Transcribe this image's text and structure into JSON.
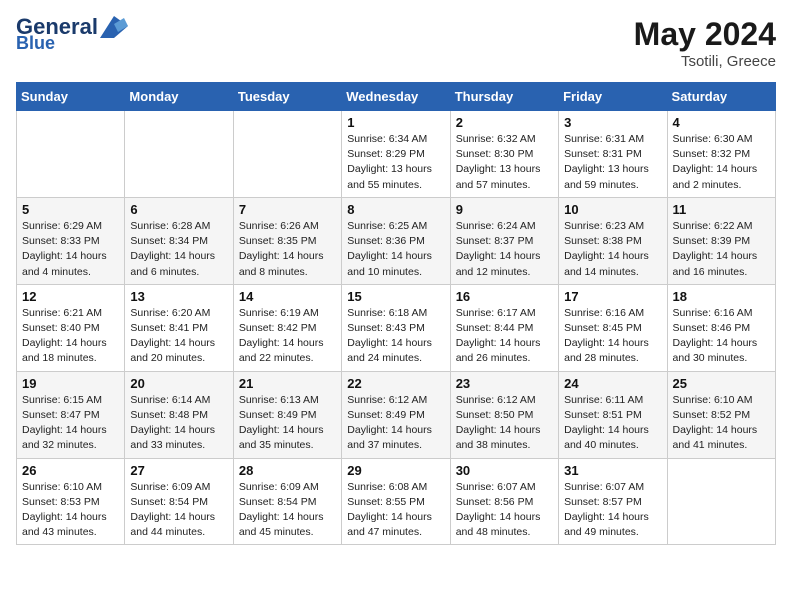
{
  "header": {
    "logo_line1": "General",
    "logo_line2": "Blue",
    "month_year": "May 2024",
    "location": "Tsotili, Greece"
  },
  "weekdays": [
    "Sunday",
    "Monday",
    "Tuesday",
    "Wednesday",
    "Thursday",
    "Friday",
    "Saturday"
  ],
  "weeks": [
    [
      {
        "day": "",
        "info": ""
      },
      {
        "day": "",
        "info": ""
      },
      {
        "day": "",
        "info": ""
      },
      {
        "day": "1",
        "info": "Sunrise: 6:34 AM\nSunset: 8:29 PM\nDaylight: 13 hours\nand 55 minutes."
      },
      {
        "day": "2",
        "info": "Sunrise: 6:32 AM\nSunset: 8:30 PM\nDaylight: 13 hours\nand 57 minutes."
      },
      {
        "day": "3",
        "info": "Sunrise: 6:31 AM\nSunset: 8:31 PM\nDaylight: 13 hours\nand 59 minutes."
      },
      {
        "day": "4",
        "info": "Sunrise: 6:30 AM\nSunset: 8:32 PM\nDaylight: 14 hours\nand 2 minutes."
      }
    ],
    [
      {
        "day": "5",
        "info": "Sunrise: 6:29 AM\nSunset: 8:33 PM\nDaylight: 14 hours\nand 4 minutes."
      },
      {
        "day": "6",
        "info": "Sunrise: 6:28 AM\nSunset: 8:34 PM\nDaylight: 14 hours\nand 6 minutes."
      },
      {
        "day": "7",
        "info": "Sunrise: 6:26 AM\nSunset: 8:35 PM\nDaylight: 14 hours\nand 8 minutes."
      },
      {
        "day": "8",
        "info": "Sunrise: 6:25 AM\nSunset: 8:36 PM\nDaylight: 14 hours\nand 10 minutes."
      },
      {
        "day": "9",
        "info": "Sunrise: 6:24 AM\nSunset: 8:37 PM\nDaylight: 14 hours\nand 12 minutes."
      },
      {
        "day": "10",
        "info": "Sunrise: 6:23 AM\nSunset: 8:38 PM\nDaylight: 14 hours\nand 14 minutes."
      },
      {
        "day": "11",
        "info": "Sunrise: 6:22 AM\nSunset: 8:39 PM\nDaylight: 14 hours\nand 16 minutes."
      }
    ],
    [
      {
        "day": "12",
        "info": "Sunrise: 6:21 AM\nSunset: 8:40 PM\nDaylight: 14 hours\nand 18 minutes."
      },
      {
        "day": "13",
        "info": "Sunrise: 6:20 AM\nSunset: 8:41 PM\nDaylight: 14 hours\nand 20 minutes."
      },
      {
        "day": "14",
        "info": "Sunrise: 6:19 AM\nSunset: 8:42 PM\nDaylight: 14 hours\nand 22 minutes."
      },
      {
        "day": "15",
        "info": "Sunrise: 6:18 AM\nSunset: 8:43 PM\nDaylight: 14 hours\nand 24 minutes."
      },
      {
        "day": "16",
        "info": "Sunrise: 6:17 AM\nSunset: 8:44 PM\nDaylight: 14 hours\nand 26 minutes."
      },
      {
        "day": "17",
        "info": "Sunrise: 6:16 AM\nSunset: 8:45 PM\nDaylight: 14 hours\nand 28 minutes."
      },
      {
        "day": "18",
        "info": "Sunrise: 6:16 AM\nSunset: 8:46 PM\nDaylight: 14 hours\nand 30 minutes."
      }
    ],
    [
      {
        "day": "19",
        "info": "Sunrise: 6:15 AM\nSunset: 8:47 PM\nDaylight: 14 hours\nand 32 minutes."
      },
      {
        "day": "20",
        "info": "Sunrise: 6:14 AM\nSunset: 8:48 PM\nDaylight: 14 hours\nand 33 minutes."
      },
      {
        "day": "21",
        "info": "Sunrise: 6:13 AM\nSunset: 8:49 PM\nDaylight: 14 hours\nand 35 minutes."
      },
      {
        "day": "22",
        "info": "Sunrise: 6:12 AM\nSunset: 8:49 PM\nDaylight: 14 hours\nand 37 minutes."
      },
      {
        "day": "23",
        "info": "Sunrise: 6:12 AM\nSunset: 8:50 PM\nDaylight: 14 hours\nand 38 minutes."
      },
      {
        "day": "24",
        "info": "Sunrise: 6:11 AM\nSunset: 8:51 PM\nDaylight: 14 hours\nand 40 minutes."
      },
      {
        "day": "25",
        "info": "Sunrise: 6:10 AM\nSunset: 8:52 PM\nDaylight: 14 hours\nand 41 minutes."
      }
    ],
    [
      {
        "day": "26",
        "info": "Sunrise: 6:10 AM\nSunset: 8:53 PM\nDaylight: 14 hours\nand 43 minutes."
      },
      {
        "day": "27",
        "info": "Sunrise: 6:09 AM\nSunset: 8:54 PM\nDaylight: 14 hours\nand 44 minutes."
      },
      {
        "day": "28",
        "info": "Sunrise: 6:09 AM\nSunset: 8:54 PM\nDaylight: 14 hours\nand 45 minutes."
      },
      {
        "day": "29",
        "info": "Sunrise: 6:08 AM\nSunset: 8:55 PM\nDaylight: 14 hours\nand 47 minutes."
      },
      {
        "day": "30",
        "info": "Sunrise: 6:07 AM\nSunset: 8:56 PM\nDaylight: 14 hours\nand 48 minutes."
      },
      {
        "day": "31",
        "info": "Sunrise: 6:07 AM\nSunset: 8:57 PM\nDaylight: 14 hours\nand 49 minutes."
      },
      {
        "day": "",
        "info": ""
      }
    ]
  ]
}
